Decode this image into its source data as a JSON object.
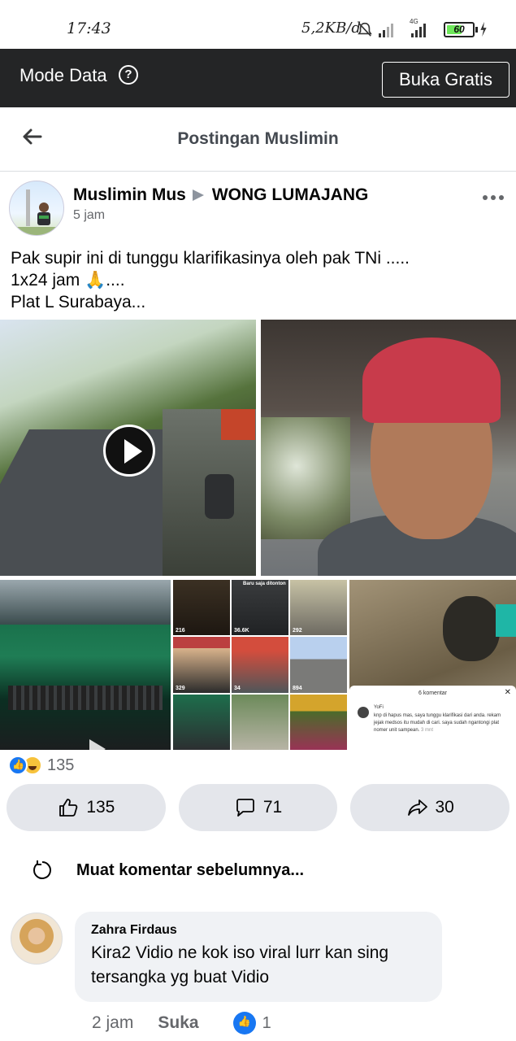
{
  "status_bar": {
    "time": "17:43",
    "network_speed": "5,2KB/d",
    "network_type": "4G",
    "battery_level": "60",
    "icons": [
      "mute-bell-icon",
      "signal-icon",
      "signal-4g-icon",
      "battery-icon",
      "charging-icon"
    ]
  },
  "mode_bar": {
    "title": "Mode Data",
    "help_symbol": "?",
    "button_label": "Buka Gratis"
  },
  "header": {
    "title": "Postingan Muslimin"
  },
  "post": {
    "author": "Muslimin Mus",
    "group": "WONG LUMAJANG",
    "time": "5 jam",
    "text_lines": [
      "Pak supir ini di tunggu klarifikasinya oleh pak TNi .....",
      "1x24 jam 🙏....",
      "Plat L Surabaya..."
    ],
    "media": {
      "grid_counts": [
        "216",
        "36.6K",
        "292",
        "329",
        "34",
        "894"
      ],
      "grid_top_label": "Baru saja ditonton",
      "comment_sheet": {
        "header": "6 komentar",
        "commenter": "YoFi",
        "comment_text": "knp di hapus mas, saya tunggu klarifikasi dari anda. rekam jejak medsos itu mudah di cari. saya sudah ngantongi plat nomer unit sampean.",
        "comment_time": "3 mnt"
      }
    },
    "reaction_count": "135",
    "actions": {
      "like_count": "135",
      "comment_count": "71",
      "share_count": "30"
    }
  },
  "comments": {
    "load_more_label": "Muat komentar sebelumnya...",
    "items": [
      {
        "name": "Zahra Firdaus",
        "text": "Kira2 Vidio ne kok iso viral lurr kan sing tersangka yg buat Vidio",
        "time": "2 jam",
        "like_label": "Suka",
        "reaction_count": "1"
      }
    ]
  },
  "colors": {
    "accent": "#1877f2",
    "mode_bar_bg": "#242526",
    "button_bg": "#e4e6eb",
    "bubble_bg": "#f0f2f5",
    "battery_fill": "#6ee85a"
  }
}
